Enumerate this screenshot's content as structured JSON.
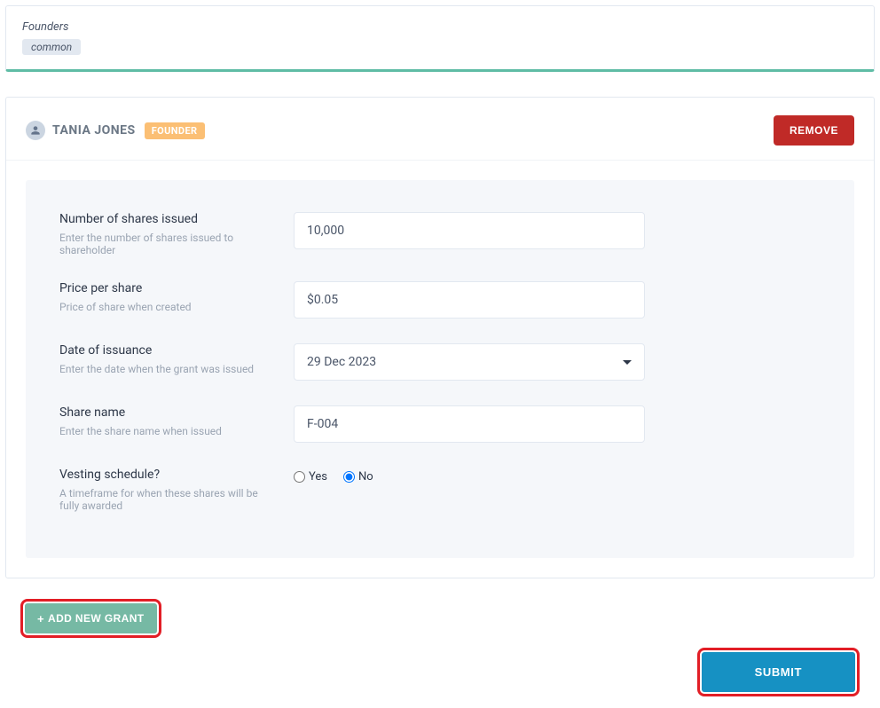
{
  "top": {
    "label": "Founders",
    "tag": "common"
  },
  "header": {
    "name": "TANIA JONES",
    "badge": "FOUNDER",
    "remove": "REMOVE"
  },
  "fields": {
    "shares": {
      "title": "Number of shares issued",
      "sub": "Enter the number of shares issued to shareholder",
      "value": "10,000"
    },
    "price": {
      "title": "Price per share",
      "sub": "Price of share when created",
      "value": "$0.05"
    },
    "date": {
      "title": "Date of issuance",
      "sub": "Enter the date when the grant was issued",
      "value": "29 Dec 2023"
    },
    "name": {
      "title": "Share name",
      "sub": "Enter the share name when issued",
      "value": "F-004"
    },
    "vesting": {
      "title": "Vesting schedule?",
      "sub": "A timeframe for when these shares will be fully awarded",
      "yes": "Yes",
      "no": "No",
      "selected": "no"
    }
  },
  "buttons": {
    "add_grant": "ADD NEW GRANT",
    "submit": "SUBMIT"
  }
}
